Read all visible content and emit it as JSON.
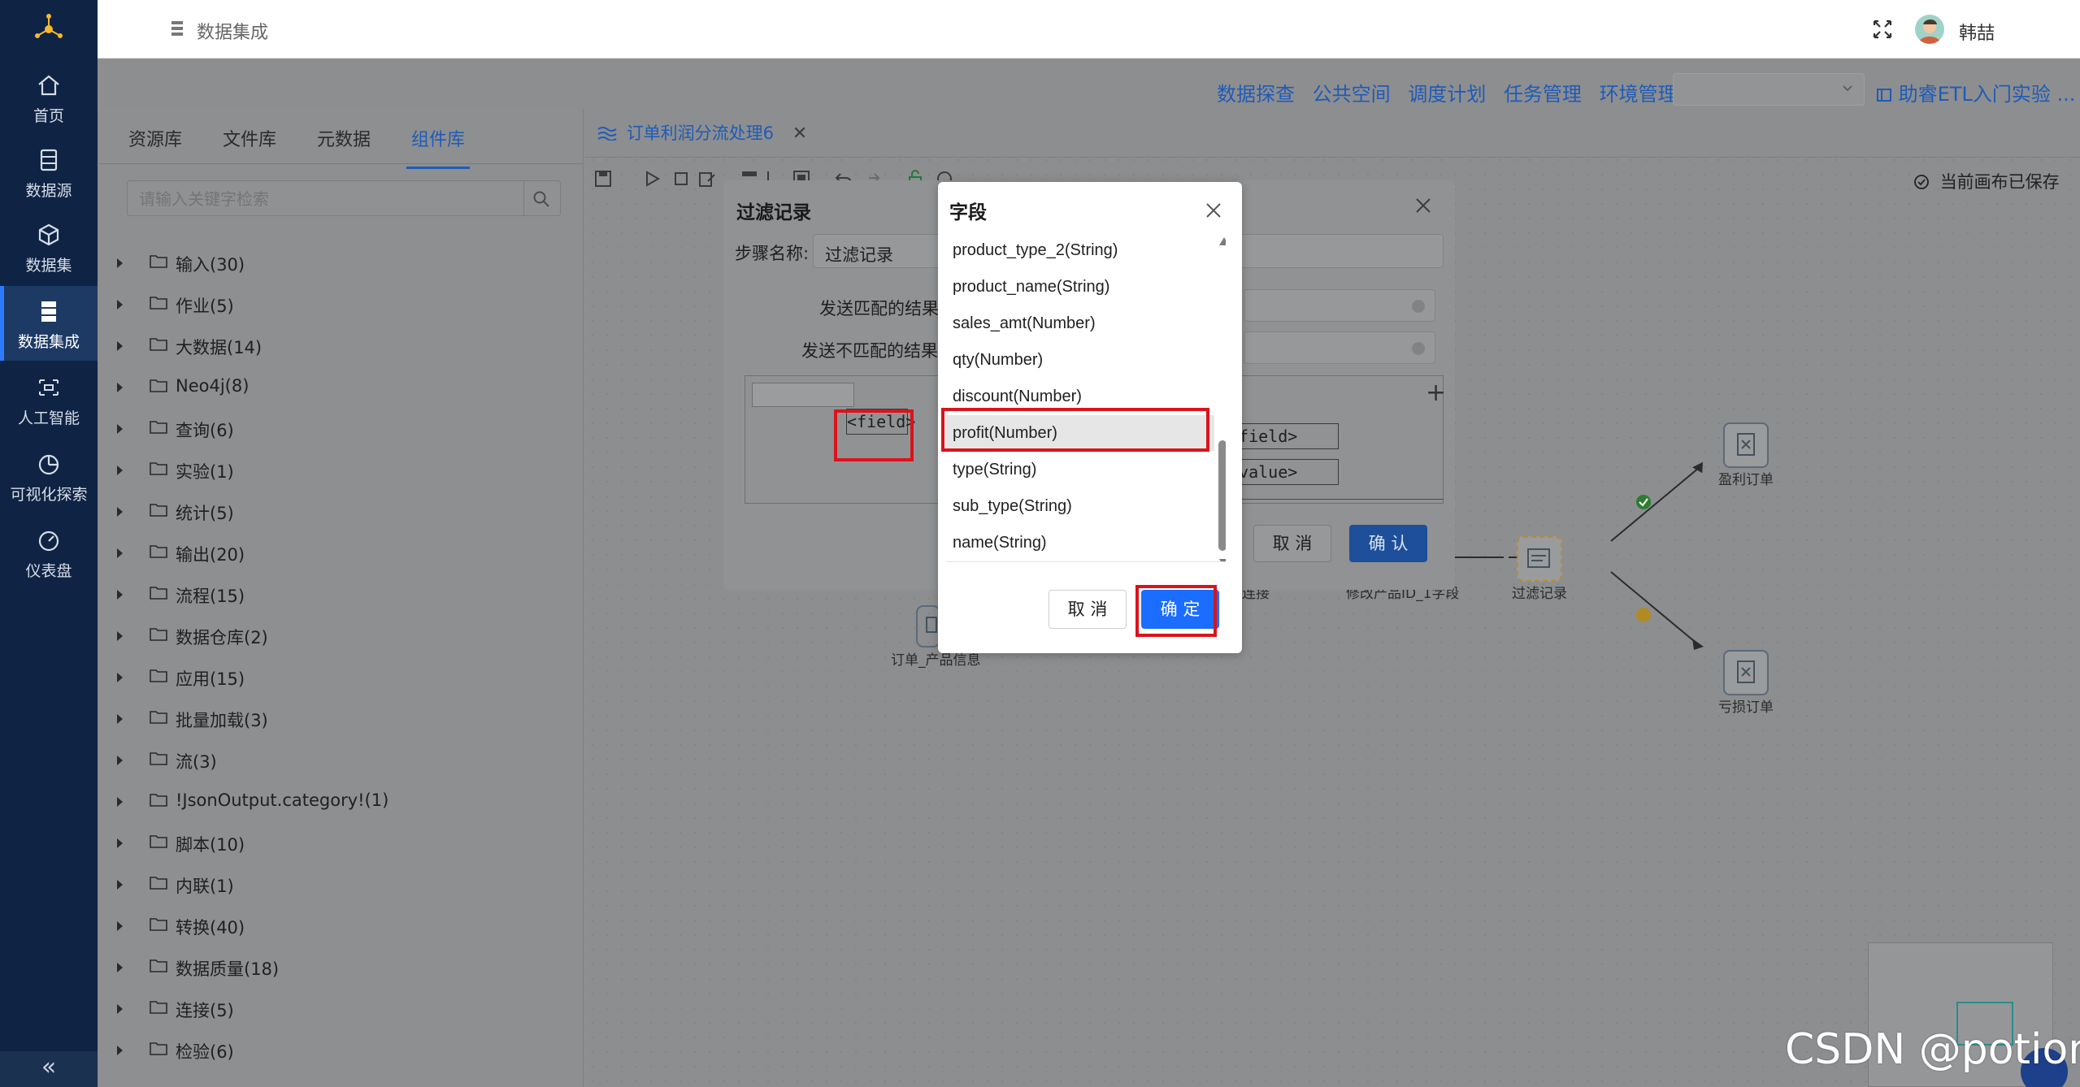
{
  "sidebar": {
    "items": [
      {
        "label": "首页",
        "icon": "home-icon"
      },
      {
        "label": "数据源",
        "icon": "database-icon"
      },
      {
        "label": "数据集",
        "icon": "cube-icon"
      },
      {
        "label": "数据集成",
        "icon": "server-icon",
        "active": true
      },
      {
        "label": "人工智能",
        "icon": "ai-icon"
      },
      {
        "label": "可视化探索",
        "icon": "pie-chart-icon"
      },
      {
        "label": "仪表盘",
        "icon": "dashboard-icon"
      }
    ],
    "collapse": "«"
  },
  "header": {
    "title": "数据集成",
    "user": "韩喆"
  },
  "topnav": {
    "links": [
      "数据探查",
      "公共空间",
      "调度计划",
      "任务管理",
      "环境管理"
    ],
    "help": "助睿ETL入门实验 ..."
  },
  "left_panel": {
    "tabs": [
      "资源库",
      "文件库",
      "元数据",
      "组件库"
    ],
    "active_tab": "组件库",
    "search_placeholder": "请输入关键字检索",
    "tree": [
      "输入(30)",
      "作业(5)",
      "大数据(14)",
      "Neo4j(8)",
      "查询(6)",
      "实验(1)",
      "统计(5)",
      "输出(20)",
      "流程(15)",
      "数据仓库(2)",
      "应用(15)",
      "批量加载(3)",
      "流(3)",
      "!JsonOutput.category!(1)",
      "脚本(10)",
      "内联(1)",
      "转换(40)",
      "数据质量(18)",
      "连接(5)",
      "检验(6)"
    ]
  },
  "canvas": {
    "tab_title": "订单利润分流处理6",
    "tab_close": "✕",
    "saved_status": "当前画布已保存",
    "nodes": {
      "profit_order": "盈利订单",
      "loss_order": "亏损订单",
      "filter": "过滤记录",
      "product_id": "修改产品ID_1字段",
      "product_info": "订单_产品信息",
      "join_tail": "连接"
    }
  },
  "filter_dialog": {
    "title": "过滤记录",
    "step_label": "步骤名称:",
    "step_value": "过滤记录",
    "match_true": "发送匹配的结果",
    "match_false": "发送不匹配的结果",
    "cond_field": "<field>",
    "cond_field_right": "<field>",
    "cond_value_right": "<value>",
    "plus": "+",
    "cancel": "取 消",
    "ok": "确 认"
  },
  "field_dialog": {
    "title": "字段",
    "items": [
      "product_type_2(String)",
      "product_name(String)",
      "sales_amt(Number)",
      "qty(Number)",
      "discount(Number)",
      "profit(Number)",
      "type(String)",
      "sub_type(String)",
      "name(String)"
    ],
    "selected": "profit(Number)",
    "cancel": "取 消",
    "ok": "确 定"
  },
  "watermark": "CSDN @potion()",
  "colors": {
    "sidebar_bg": "#0f2444",
    "primary": "#1a6dff",
    "annotation_red": "#d9141b"
  }
}
